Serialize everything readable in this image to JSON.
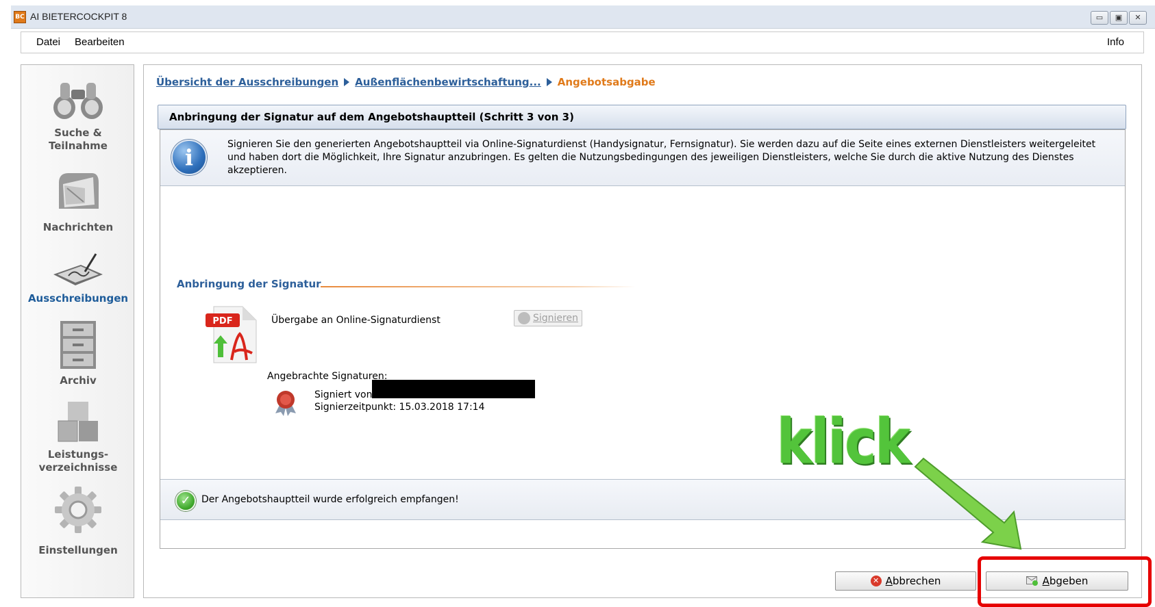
{
  "window": {
    "title": "AI BIETERCOCKPIT 8",
    "app_icon_text": "BC",
    "buttons": [
      "▭",
      "▣",
      "✕"
    ]
  },
  "menu": {
    "items": [
      "Datei",
      "Bearbeiten"
    ],
    "info": "Info"
  },
  "sidebar": {
    "items": [
      {
        "label_line1": "Suche &",
        "label_line2": "Teilnahme",
        "icon": "binoculars-icon"
      },
      {
        "label_line1": "Nachrichten",
        "label_line2": "",
        "icon": "mailbox-icon"
      },
      {
        "label_line1": "Ausschreibungen",
        "label_line2": "",
        "icon": "signature-pad-icon"
      },
      {
        "label_line1": "Archiv",
        "label_line2": "",
        "icon": "file-cabinet-icon"
      },
      {
        "label_line1": "Leistungs-",
        "label_line2": "verzeichnisse",
        "icon": "boxes-icon"
      },
      {
        "label_line1": "Einstellungen",
        "label_line2": "",
        "icon": "gear-icon"
      }
    ]
  },
  "breadcrumb": {
    "link1": "Übersicht der Ausschreibungen",
    "link2": "Außenflächenbewirtschaftung...",
    "current": "Angebotsabgabe"
  },
  "step": {
    "header": "Anbringung der Signatur auf dem Angebotshauptteil (Schritt 3 von 3)"
  },
  "info": {
    "icon_letter": "i",
    "text": "Signieren Sie den generierten Angebotshauptteil via Online-Signaturdienst (Handysignatur, Fernsignatur). Sie werden dazu auf die Seite eines externen Dienstleisters weitergeleitet und haben dort die Möglichkeit, Ihre Signatur anzubringen. Es gelten die Nutzungsbedingungen des jeweiligen Dienstleisters, welche Sie durch die aktive Nutzung des Dienstes akzeptieren."
  },
  "signature": {
    "section_title": "Anbringung der Signatur",
    "pdf_badge": "PDF",
    "handover_label": "Übergabe an Online-Signaturdienst",
    "sign_button": "Signieren",
    "applied_label": "Angebrachte Signaturen:",
    "signed_by_label": "Signiert von:",
    "timestamp": "Signierzeitpunkt: 15.03.2018 17:14"
  },
  "status": {
    "message": "Der Angebotshauptteil wurde erfolgreich empfangen!"
  },
  "actions": {
    "cancel": "Abbrechen",
    "submit": "Abgeben"
  },
  "annotation": {
    "text": "klick"
  },
  "colors": {
    "accent_blue": "#2d5f9a",
    "accent_orange": "#e07a1a",
    "highlight_red": "#e60000",
    "annotation_green": "#53c43b"
  }
}
